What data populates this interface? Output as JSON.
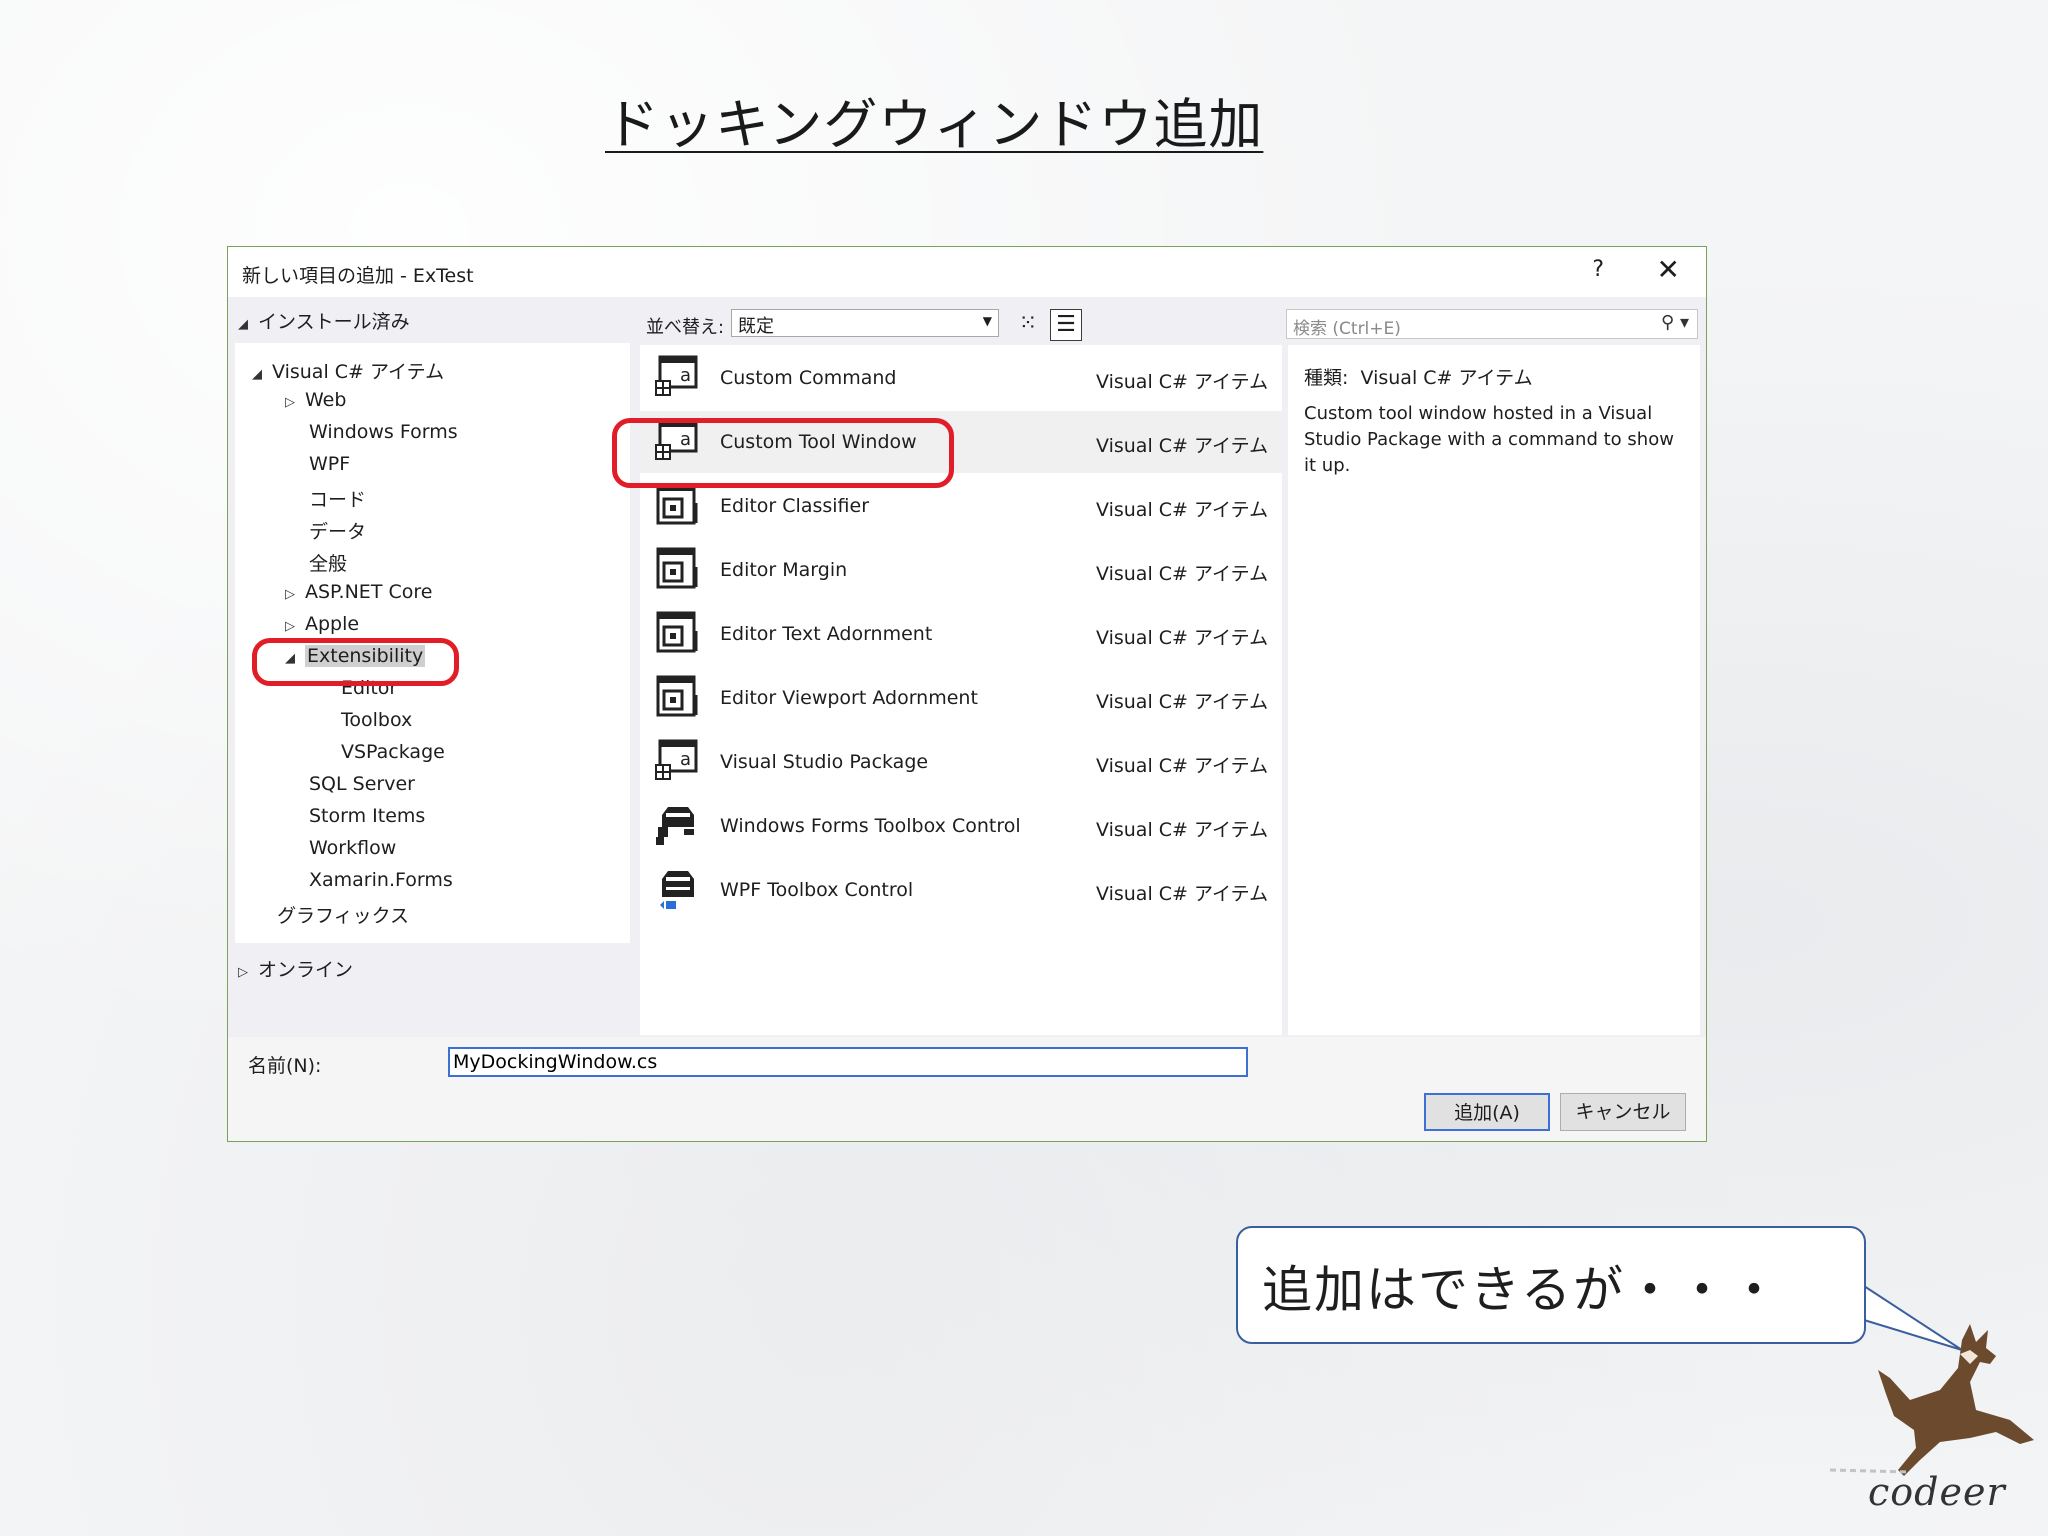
{
  "slide_title": "ドッキングウィンドウ追加",
  "dialog": {
    "title": "新しい項目の追加 - ExTest",
    "help_label": "?",
    "close_label": "✕",
    "installed_label": "インストール済み",
    "online_label": "オンライン",
    "tree": {
      "visual_csharp": "Visual C# アイテム",
      "web": "Web",
      "windows_forms": "Windows Forms",
      "wpf": "WPF",
      "code": "コード",
      "data": "データ",
      "general": "全般",
      "aspnet_core": "ASP.NET Core",
      "apple": "Apple",
      "extensibility": "Extensibility",
      "editor": "Editor",
      "toolbox": "Toolbox",
      "vspackage": "VSPackage",
      "sql_server": "SQL Server",
      "storm_items": "Storm Items",
      "workflow": "Workflow",
      "xamarin_forms": "Xamarin.Forms",
      "graphics": "グラフィックス"
    },
    "sort_label": "並べ替え:",
    "sort_value": "既定",
    "search_placeholder": "検索 (Ctrl+E)",
    "templates": [
      {
        "name": "Custom Command",
        "type": "Visual C# アイテム",
        "icon": "package-item-icon"
      },
      {
        "name": "Custom Tool Window",
        "type": "Visual C# アイテム",
        "icon": "package-item-icon"
      },
      {
        "name": "Editor Classifier",
        "type": "Visual C# アイテム",
        "icon": "editor-extension-icon"
      },
      {
        "name": "Editor Margin",
        "type": "Visual C# アイテム",
        "icon": "editor-extension-icon"
      },
      {
        "name": "Editor Text Adornment",
        "type": "Visual C# アイテム",
        "icon": "editor-extension-icon"
      },
      {
        "name": "Editor Viewport Adornment",
        "type": "Visual C# アイテム",
        "icon": "editor-extension-icon"
      },
      {
        "name": "Visual Studio Package",
        "type": "Visual C# アイテム",
        "icon": "package-item-icon"
      },
      {
        "name": "Windows Forms Toolbox Control",
        "type": "Visual C# アイテム",
        "icon": "toolbox-control-icon"
      },
      {
        "name": "WPF Toolbox Control",
        "type": "Visual C# アイテム",
        "icon": "wpf-toolbox-control-icon"
      }
    ],
    "description": {
      "kind_label": "種類:",
      "kind_value": "Visual C# アイテム",
      "text": "Custom tool window hosted in a Visual Studio Package with a command to show it up."
    },
    "name_label": "名前(N):",
    "name_value": "MyDockingWindow.cs",
    "add_button": "追加(A)",
    "cancel_button": "キャンセル"
  },
  "callout": "追加はできるが・・・",
  "brand": "codeer",
  "colors": {
    "highlight_red": "#e11d27",
    "focus_blue": "#3d6fd6",
    "dialog_border": "#7aa35a"
  }
}
